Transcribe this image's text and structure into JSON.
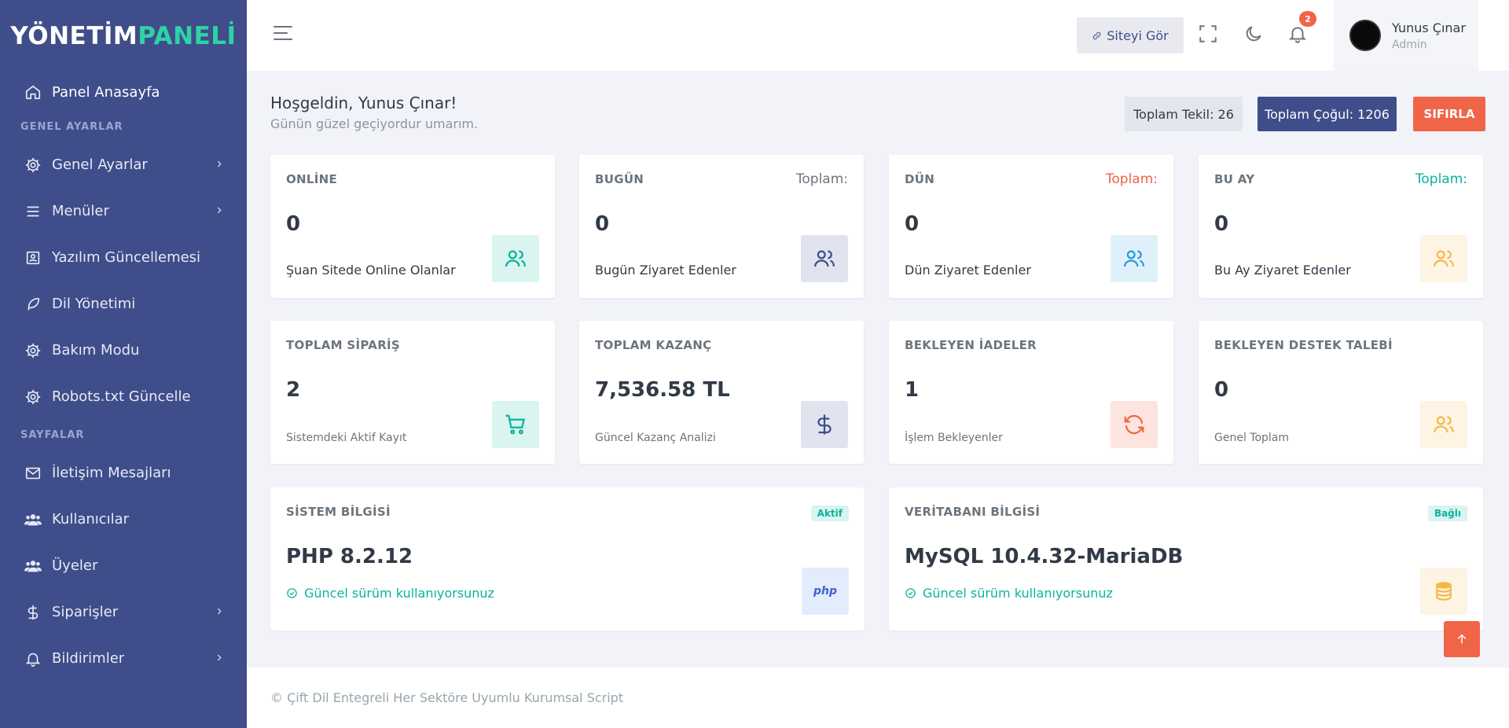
{
  "brand": {
    "part1": "YÖNETİM",
    "part2": "PANELİ"
  },
  "sidebar": {
    "home": "Panel Anasayfa",
    "section1": "GENEL AYARLAR",
    "section2": "SAYFALAR",
    "items1": [
      {
        "label": "Genel Ayarlar",
        "icon": "gear-icon",
        "chevron": true
      },
      {
        "label": "Menüler",
        "icon": "menu-icon",
        "chevron": true
      },
      {
        "label": "Yazılım Güncellemesi",
        "icon": "update-icon",
        "chevron": false
      },
      {
        "label": "Dil Yönetimi",
        "icon": "feather-icon",
        "chevron": false
      },
      {
        "label": "Bakım Modu",
        "icon": "gear-icon",
        "chevron": false
      },
      {
        "label": "Robots.txt Güncelle",
        "icon": "gear-icon",
        "chevron": false
      }
    ],
    "items2": [
      {
        "label": "İletişim Mesajları",
        "icon": "mail-icon",
        "chevron": false
      },
      {
        "label": "Kullanıcılar",
        "icon": "users-icon",
        "chevron": false
      },
      {
        "label": "Üyeler",
        "icon": "users-icon",
        "chevron": false
      },
      {
        "label": "Siparişler",
        "icon": "dollar-icon",
        "chevron": true
      },
      {
        "label": "Bildirimler",
        "icon": "bell-icon",
        "chevron": true
      }
    ]
  },
  "topbar": {
    "site_button": "Siteyi Gör",
    "notif_count": "2",
    "user_name": "Yunus Çınar",
    "user_role": "Admin"
  },
  "welcome": {
    "title": "Hoşgeldin, Yunus Çınar!",
    "subtitle": "Günün güzel geçiyordur umarım.",
    "tekil": "Toplam Tekil: 26",
    "cogul": "Toplam Çoğul: 1206",
    "reset": "SIFIRLA"
  },
  "cards_row1": [
    {
      "label": "ONLİNE",
      "toplam": "",
      "value": "0",
      "desc": "Şuan Sitede Online Olanlar"
    },
    {
      "label": "BUGÜN",
      "toplam": "Toplam:",
      "value": "0",
      "desc": "Bugün Ziyaret Edenler"
    },
    {
      "label": "DÜN",
      "toplam": "Toplam:",
      "value": "0",
      "desc": "Dün Ziyaret Edenler"
    },
    {
      "label": "BU AY",
      "toplam": "Toplam:",
      "value": "0",
      "desc": "Bu Ay Ziyaret Edenler"
    }
  ],
  "cards_row2": [
    {
      "label": "TOPLAM SİPARİŞ",
      "value": "2",
      "desc": "Sistemdeki Aktif Kayıt"
    },
    {
      "label": "TOPLAM KAZANÇ",
      "value": "7,536.58 TL",
      "desc": "Güncel Kazanç Analizi"
    },
    {
      "label": "BEKLEYEN İADELER",
      "value": "1",
      "desc": "İşlem Bekleyenler"
    },
    {
      "label": "BEKLEYEN DESTEK TALEBİ",
      "value": "0",
      "desc": "Genel Toplam"
    }
  ],
  "system": {
    "label": "SİSTEM BİLGİSİ",
    "chip": "Aktif",
    "value": "PHP 8.2.12",
    "status": "Güncel sürüm kullanıyorsunuz",
    "icon_text": "php"
  },
  "database": {
    "label": "VERİTABANI BİLGİSİ",
    "chip": "Bağlı",
    "value": "MySQL 10.4.32-MariaDB",
    "status": "Güncel sürüm kullanıyorsunuz"
  },
  "footer": "© Çift Dil Entegreli Her Sektöre Uyumlu Kurumsal Script",
  "colors": {
    "sidebar": "#3f4d8a",
    "accent_green": "#0ab39c",
    "accent_red": "#f06548",
    "accent_blue": "#299cdb",
    "accent_yellow": "#f7b84b"
  }
}
